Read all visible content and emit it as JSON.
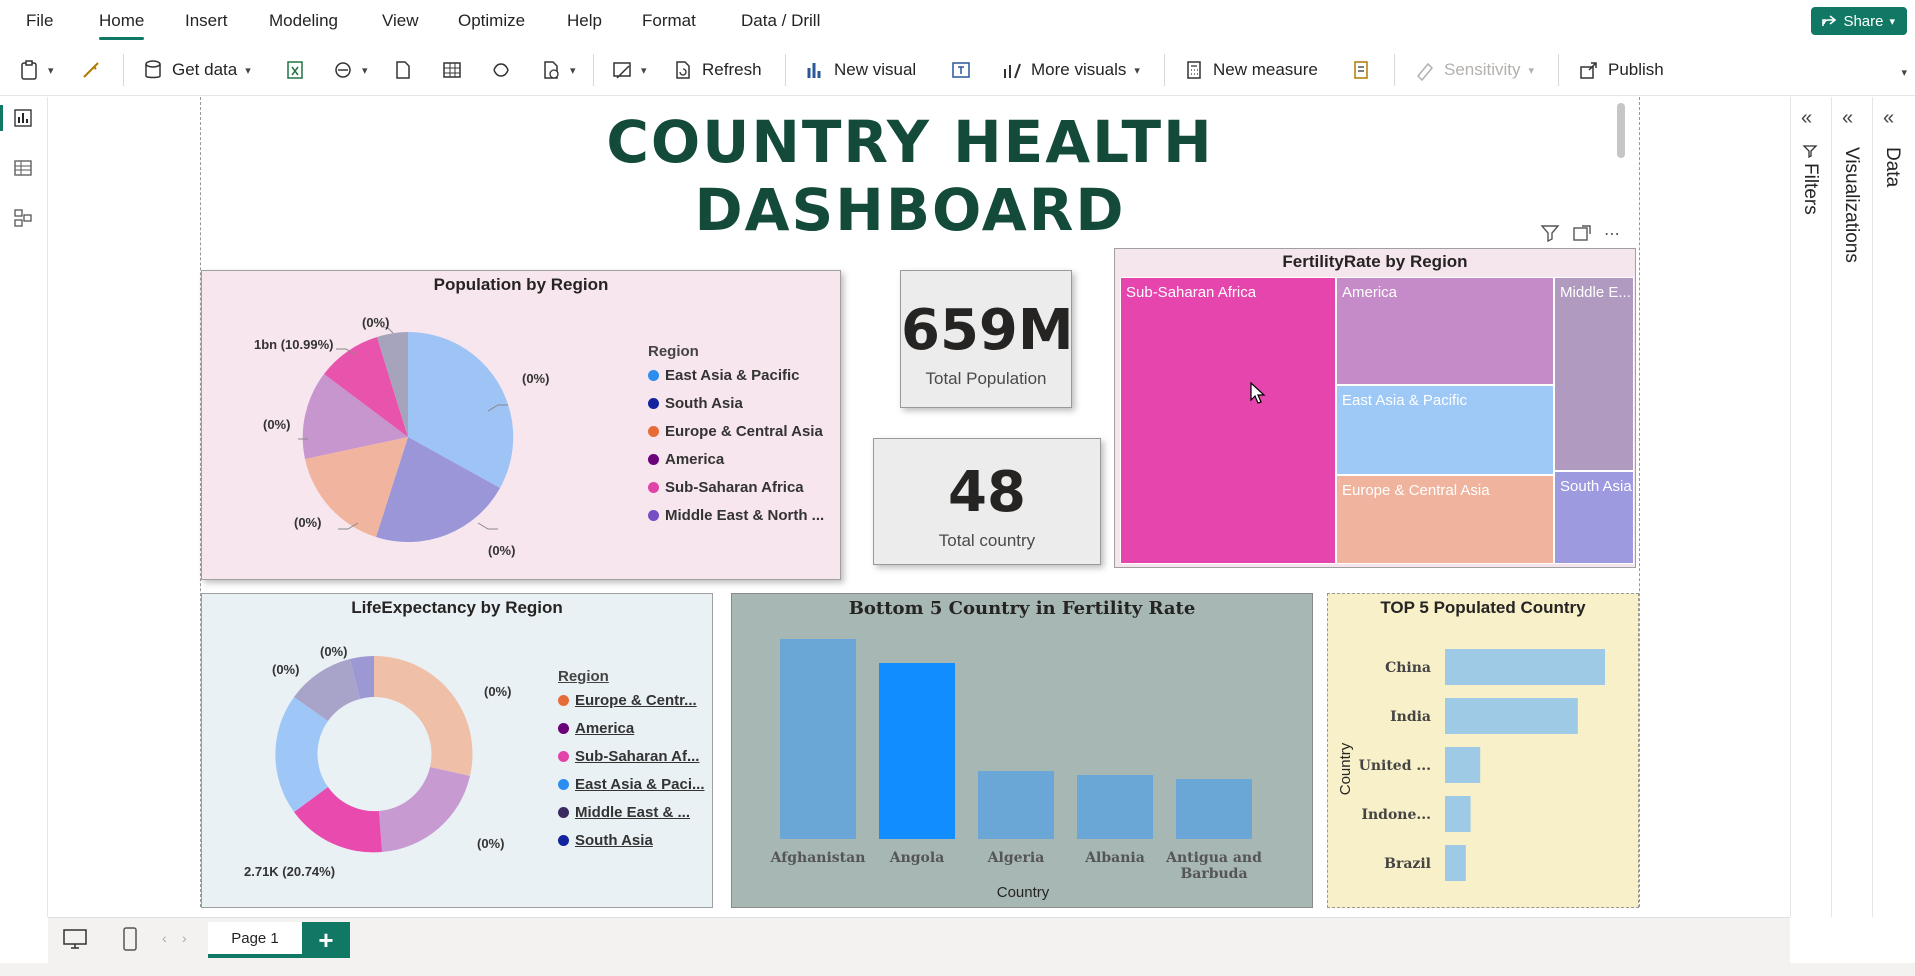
{
  "menu": {
    "items": [
      "File",
      "Home",
      "Insert",
      "Modeling",
      "View",
      "Optimize",
      "Help",
      "Format",
      "Data / Drill"
    ],
    "active": "Home",
    "share_label": "Share"
  },
  "toolbar": {
    "get_data": "Get data",
    "refresh": "Refresh",
    "new_visual": "New visual",
    "more_visuals": "More visuals",
    "new_measure": "New measure",
    "sensitivity": "Sensitivity",
    "publish": "Publish"
  },
  "report": {
    "title": "COUNTRY HEALTH DASHBOARD"
  },
  "population_by_region": {
    "title": "Population by Region",
    "legend_title": "Region",
    "legend": [
      {
        "label": "East Asia & Pacific",
        "color": "#2e8ef0"
      },
      {
        "label": "South Asia",
        "color": "#12239e"
      },
      {
        "label": "Europe & Central Asia",
        "color": "#e66c37"
      },
      {
        "label": "America",
        "color": "#6b007b"
      },
      {
        "label": "Sub-Saharan Africa",
        "color": "#e044a7"
      },
      {
        "label": "Middle East & North ...",
        "color": "#744ec2"
      }
    ],
    "labels": [
      "(0%)",
      "(0%)",
      "(0%)",
      "(0%)",
      "(0%)",
      "1bn (10.99%)"
    ]
  },
  "kpis": {
    "total_population_value": "659M",
    "total_population_label": "Total Population",
    "total_country_value": "48",
    "total_country_label": "Total country"
  },
  "fertility_by_region": {
    "title": "FertilityRate by Region",
    "cells": [
      "Sub-Saharan Africa",
      "America",
      "Middle E...",
      "East Asia & Pacific",
      "Europe & Central Asia",
      "South Asia"
    ]
  },
  "life_expectancy": {
    "title": "LifeExpectancy by Region",
    "legend_title": "Region",
    "legend": [
      {
        "label": "Europe & Centr...",
        "color": "#e66c37"
      },
      {
        "label": "America",
        "color": "#6b007b"
      },
      {
        "label": "Sub-Saharan Af...",
        "color": "#e044a7"
      },
      {
        "label": "East Asia & Paci...",
        "color": "#2e8ef0"
      },
      {
        "label": "Middle East & ...",
        "color": "#3a2b5e"
      },
      {
        "label": "South Asia",
        "color": "#12239e"
      }
    ],
    "labels": [
      "(0%)",
      "(0%)",
      "(0%)",
      "(0%)",
      "2.71K (20.74%)"
    ]
  },
  "chart_data": [
    {
      "type": "bar",
      "title": "Bottom 5 Country in Fertility Rate",
      "xlabel": "Country",
      "ylabel": "",
      "categories": [
        "Afghanistan",
        "Angola",
        "Algeria",
        "Albania",
        "Antigua and Barbuda"
      ],
      "values": [
        100,
        88,
        34,
        32,
        30
      ],
      "highlight_index": 1,
      "bar_color": "#6aa6d6",
      "highlight_color": "#118dff"
    },
    {
      "type": "bar",
      "orientation": "horizontal",
      "title": "TOP 5 Populated Country",
      "ylabel": "Country",
      "categories": [
        "China",
        "India",
        "United ...",
        "Indone...",
        "Brazil"
      ],
      "values": [
        100,
        83,
        22,
        16,
        13
      ],
      "bar_color": "#9ecae6"
    }
  ],
  "pages": {
    "current": "Page 1"
  }
}
